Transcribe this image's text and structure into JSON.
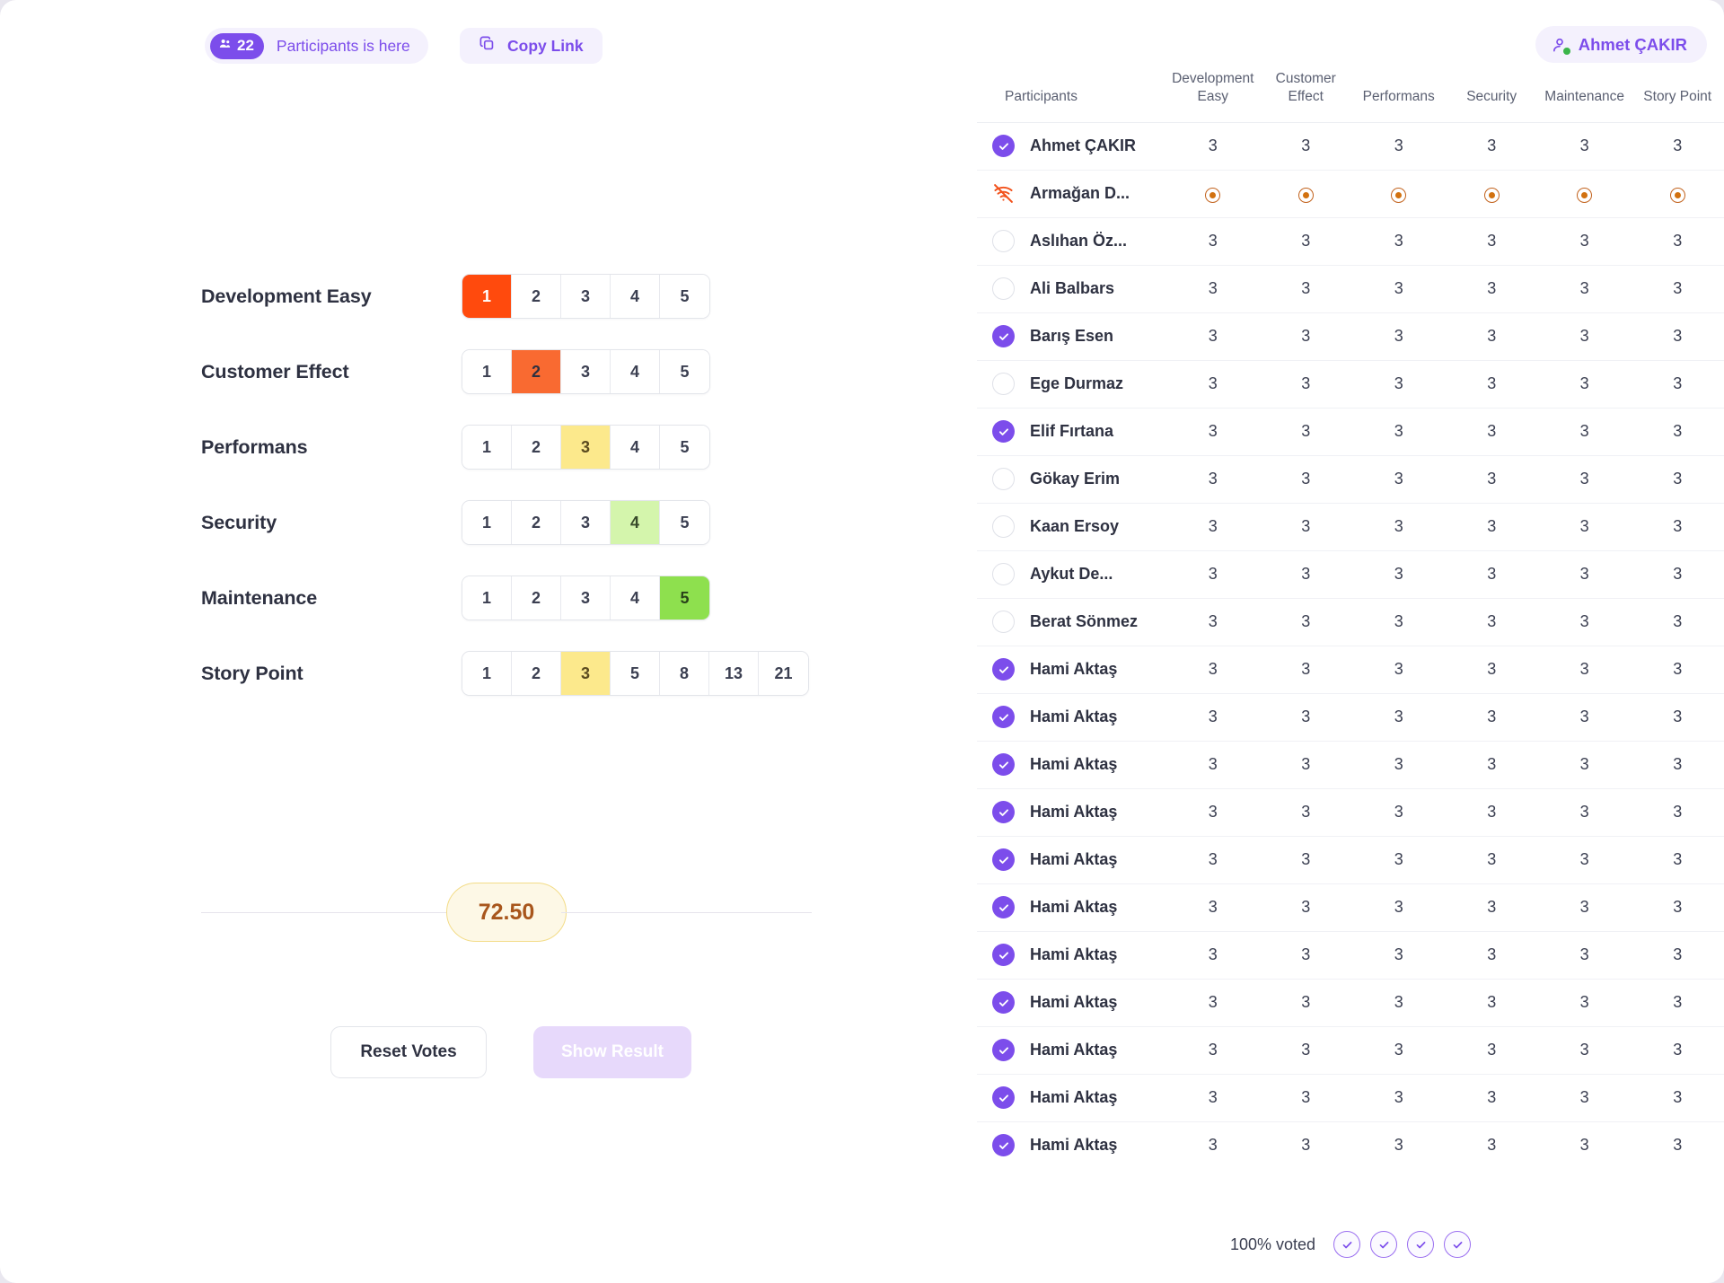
{
  "topbar": {
    "participants_count": "22",
    "participants_label": "Participants is here",
    "copy_link_label": "Copy Link",
    "user_name": "Ahmet ÇAKIR"
  },
  "voting": {
    "rows": [
      {
        "label": "Development Easy",
        "options": [
          "1",
          "2",
          "3",
          "4",
          "5"
        ],
        "selected_index": 0,
        "selected_style": "sel-red"
      },
      {
        "label": "Customer Effect",
        "options": [
          "1",
          "2",
          "3",
          "4",
          "5"
        ],
        "selected_index": 1,
        "selected_style": "sel-orange"
      },
      {
        "label": "Performans",
        "options": [
          "1",
          "2",
          "3",
          "4",
          "5"
        ],
        "selected_index": 2,
        "selected_style": "sel-yellow"
      },
      {
        "label": "Security",
        "options": [
          "1",
          "2",
          "3",
          "4",
          "5"
        ],
        "selected_index": 3,
        "selected_style": "sel-paleGreen"
      },
      {
        "label": "Maintenance",
        "options": [
          "1",
          "2",
          "3",
          "4",
          "5"
        ],
        "selected_index": 4,
        "selected_style": "sel-green"
      },
      {
        "label": "Story Point",
        "options": [
          "1",
          "2",
          "3",
          "5",
          "8",
          "13",
          "21"
        ],
        "selected_index": 2,
        "selected_style": "sel-yellow"
      }
    ],
    "score": "72.50",
    "reset_label": "Reset Votes",
    "show_result_label": "Show Result"
  },
  "table": {
    "columns": [
      "Participants",
      "Development Easy",
      "Customer Effect",
      "Performans",
      "Security",
      "Maintenance",
      "Story Point"
    ],
    "rows": [
      {
        "name": "Ahmet ÇAKIR",
        "status": "voted",
        "values": [
          "3",
          "3",
          "3",
          "3",
          "3",
          "3"
        ]
      },
      {
        "name": "Armağan D...",
        "status": "offline",
        "values": [
          "dot",
          "dot",
          "dot",
          "dot",
          "dot",
          "dot"
        ]
      },
      {
        "name": "Aslıhan Öz...",
        "status": "pending",
        "values": [
          "3",
          "3",
          "3",
          "3",
          "3",
          "3"
        ]
      },
      {
        "name": "Ali Balbars",
        "status": "pending",
        "values": [
          "3",
          "3",
          "3",
          "3",
          "3",
          "3"
        ]
      },
      {
        "name": "Barış Esen",
        "status": "voted",
        "values": [
          "3",
          "3",
          "3",
          "3",
          "3",
          "3"
        ]
      },
      {
        "name": "Ege Durmaz",
        "status": "pending",
        "values": [
          "3",
          "3",
          "3",
          "3",
          "3",
          "3"
        ]
      },
      {
        "name": "Elif Fırtana",
        "status": "voted",
        "values": [
          "3",
          "3",
          "3",
          "3",
          "3",
          "3"
        ]
      },
      {
        "name": "Gökay Erim",
        "status": "pending",
        "values": [
          "3",
          "3",
          "3",
          "3",
          "3",
          "3"
        ]
      },
      {
        "name": "Kaan Ersoy",
        "status": "pending",
        "values": [
          "3",
          "3",
          "3",
          "3",
          "3",
          "3"
        ]
      },
      {
        "name": "Aykut De...",
        "status": "pending",
        "values": [
          "3",
          "3",
          "3",
          "3",
          "3",
          "3"
        ]
      },
      {
        "name": "Berat Sönmez",
        "status": "pending",
        "values": [
          "3",
          "3",
          "3",
          "3",
          "3",
          "3"
        ]
      },
      {
        "name": "Hami Aktaş",
        "status": "voted",
        "values": [
          "3",
          "3",
          "3",
          "3",
          "3",
          "3"
        ]
      },
      {
        "name": "Hami Aktaş",
        "status": "voted",
        "values": [
          "3",
          "3",
          "3",
          "3",
          "3",
          "3"
        ]
      },
      {
        "name": "Hami Aktaş",
        "status": "voted",
        "values": [
          "3",
          "3",
          "3",
          "3",
          "3",
          "3"
        ]
      },
      {
        "name": "Hami Aktaş",
        "status": "voted",
        "values": [
          "3",
          "3",
          "3",
          "3",
          "3",
          "3"
        ]
      },
      {
        "name": "Hami Aktaş",
        "status": "voted",
        "values": [
          "3",
          "3",
          "3",
          "3",
          "3",
          "3"
        ]
      },
      {
        "name": "Hami Aktaş",
        "status": "voted",
        "values": [
          "3",
          "3",
          "3",
          "3",
          "3",
          "3"
        ]
      },
      {
        "name": "Hami Aktaş",
        "status": "voted",
        "values": [
          "3",
          "3",
          "3",
          "3",
          "3",
          "3"
        ]
      },
      {
        "name": "Hami Aktaş",
        "status": "voted",
        "values": [
          "3",
          "3",
          "3",
          "3",
          "3",
          "3"
        ]
      },
      {
        "name": "Hami Aktaş",
        "status": "voted",
        "values": [
          "3",
          "3",
          "3",
          "3",
          "3",
          "3"
        ]
      },
      {
        "name": "Hami Aktaş",
        "status": "voted",
        "values": [
          "3",
          "3",
          "3",
          "3",
          "3",
          "3"
        ]
      },
      {
        "name": "Hami Aktaş",
        "status": "voted",
        "values": [
          "3",
          "3",
          "3",
          "3",
          "3",
          "3"
        ]
      }
    ],
    "footer_text": "100% voted",
    "footer_check_count": 4
  },
  "colors": {
    "accent_purple": "#7c4deb",
    "accent_purple_light": "#f4f1fd",
    "vote_red": "#ff4a0d",
    "vote_orange": "#f96a31",
    "vote_yellow": "#fce98c",
    "vote_pale_green": "#d4f5ac",
    "vote_green": "#8ee04e",
    "offline_orange": "#d2710f",
    "score_text": "#a8561c"
  }
}
